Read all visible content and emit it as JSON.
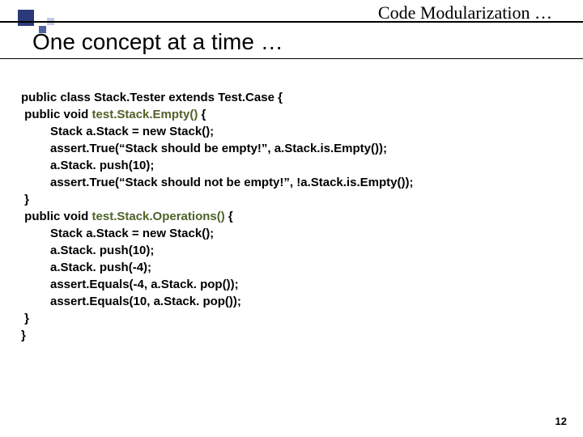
{
  "eyebrow": "Code Modularization …",
  "title": "One concept at a time …",
  "page_number": "12",
  "code": {
    "l1": "public class Stack.Tester extends Test.Case {",
    "l2a": " public void ",
    "l2b": "test.Stack.Empty()",
    "l2c": " {",
    "l3": "Stack a.Stack = new Stack();",
    "l4": "assert.True(“Stack should be empty!”, a.Stack.is.Empty());",
    "l5": "a.Stack. push(10);",
    "l6": "assert.True(“Stack should not be empty!”, !a.Stack.is.Empty());",
    "l7": " }",
    "l8a": " public void ",
    "l8b": "test.Stack.Operations()",
    "l8c": " {",
    "l9": "Stack a.Stack = new Stack();",
    "l10": "a.Stack. push(10);",
    "l11": "a.Stack. push(-4);",
    "l12": "assert.Equals(-4, a.Stack. pop());",
    "l13": "assert.Equals(10, a.Stack. pop());",
    "l14": " }",
    "l15": "}"
  }
}
